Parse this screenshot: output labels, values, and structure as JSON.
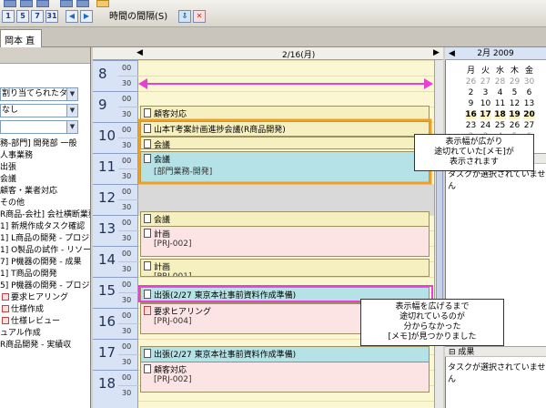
{
  "toolbar": {
    "day_buttons": [
      "1",
      "5",
      "7",
      "31"
    ],
    "view_menu": "時間の間隔(S)"
  },
  "tabs": [
    {
      "label": "岡本 直哉"
    }
  ],
  "left_panel": {
    "assigned_label": "割り当てられたタス",
    "filter_value": "なし",
    "tree": [
      "務-部門] 開発部 一般",
      "人事業務",
      "出張",
      "会議",
      "顧客・業者対応",
      "その他",
      "R商品-会社] 会社横断業務",
      "1] 新規作成タスク確認",
      "1] L商品の開発 - プロジェ",
      "1] O製品の試作 - リソー",
      "7] P機器の開発 - 成果",
      "1] T商品の開発",
      "5] P機器の開発 - プロジ",
      "要求ヒアリング",
      "仕様作成",
      "仕様レビュー",
      "ュアル作成",
      "R商品開発 - 実績収"
    ]
  },
  "scheduler": {
    "date": "2/16(月)",
    "hours": [
      "8",
      "9",
      "10",
      "11",
      "12",
      "13",
      "14",
      "15",
      "16",
      "17",
      "18"
    ],
    "minutes": [
      "00",
      "30"
    ],
    "appointments": [
      {
        "title": "顧客対応",
        "sub": ""
      },
      {
        "title": "山本T考案計画進捗会議(R商品開発)",
        "sub": ""
      },
      {
        "title": "会議",
        "sub": ""
      },
      {
        "title": "会議",
        "sub": "[部門業務-開発]"
      },
      {
        "title": "会議",
        "sub": ""
      },
      {
        "title": "計画",
        "sub": "[PRJ-002]"
      },
      {
        "title": "計画",
        "sub": "[PRJ-001]"
      },
      {
        "title": "出張(2/27  東京本社事前資料作成準備)",
        "sub": ""
      },
      {
        "title": "要求ヒアリング",
        "sub": "[PRJ-004]"
      },
      {
        "title": "出張(2/27  東京本社事前資料作成準備)",
        "sub": ""
      },
      {
        "title": "顧客対応",
        "sub": "[PRJ-002]"
      }
    ]
  },
  "calendar": {
    "month_label": "2月 2009",
    "weekdays": [
      "月",
      "火",
      "水",
      "木",
      "金"
    ],
    "weeks": [
      [
        "26",
        "27",
        "28",
        "29",
        "30"
      ],
      [
        "2",
        "3",
        "4",
        "5",
        "6"
      ],
      [
        "9",
        "10",
        "11",
        "12",
        "13"
      ],
      [
        "16",
        "17",
        "18",
        "19",
        "20"
      ],
      [
        "23",
        "24",
        "25",
        "26",
        "27"
      ],
      [
        "2",
        "3",
        "4",
        "5",
        "6"
      ]
    ]
  },
  "right_panel": {
    "task_status_1": "タスクが選択されていません",
    "results_label": "成果",
    "task_status_2": "タスクが選択されていません"
  },
  "callouts": {
    "callout_1": [
      "表示幅が広がり",
      "途切れていた[メモ]が",
      "表示されます"
    ],
    "callout_2": [
      "表示幅を広げるまで",
      "途切れているのが",
      "分からなかった",
      "[メモ]が見つかりました"
    ]
  },
  "colors": {
    "magenta": "#e83fd6",
    "orange": "#f0a020",
    "today_highlight": "#fff4c2"
  }
}
